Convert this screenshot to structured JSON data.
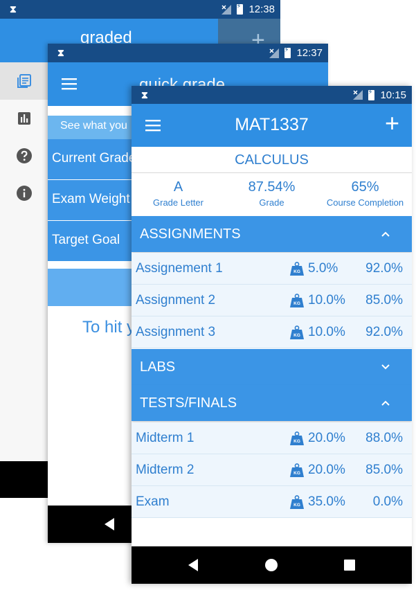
{
  "screen1": {
    "status_time": "12:38",
    "app_title": "graded",
    "plus_symbol": "+",
    "drawer_icons": [
      "list-icon",
      "chart-icon",
      "help-icon",
      "info-icon"
    ]
  },
  "screen2": {
    "status_time": "12:37",
    "app_title": "quick grade",
    "subtitle": "See what you",
    "rows": [
      "Current Grade",
      "Exam Weight",
      "Target Goal"
    ],
    "hint": "To hit y"
  },
  "screen3": {
    "status_time": "10:15",
    "title": "MAT1337",
    "plus_symbol": "+",
    "course_name": "CALCULUS",
    "stats": [
      {
        "value": "A",
        "label": "Grade Letter"
      },
      {
        "value": "87.54%",
        "label": "Grade"
      },
      {
        "value": "65%",
        "label": "Course Completion"
      }
    ],
    "sections": {
      "assignments": {
        "name": "ASSIGNMENTS",
        "expanded": true,
        "items": [
          {
            "name": "Assignement 1",
            "weight": "5.0%",
            "grade": "92.0%"
          },
          {
            "name": "Assignment 2",
            "weight": "10.0%",
            "grade": "85.0%"
          },
          {
            "name": "Assignment 3",
            "weight": "10.0%",
            "grade": "92.0%"
          }
        ]
      },
      "labs": {
        "name": "LABS",
        "expanded": false,
        "items": []
      },
      "tests": {
        "name": "TESTS/FINALS",
        "expanded": true,
        "items": [
          {
            "name": "Midterm 1",
            "weight": "20.0%",
            "grade": "88.0%"
          },
          {
            "name": "Midterm 2",
            "weight": "20.0%",
            "grade": "85.0%"
          },
          {
            "name": "Exam",
            "weight": "35.0%",
            "grade": "0.0%"
          }
        ]
      }
    },
    "kg_badge": "KG"
  },
  "colors": {
    "status_bar": "#174c86",
    "app_bar": "#2f8fe3",
    "accent_text": "#2f7fcf",
    "row_background": "#eef6fd"
  }
}
